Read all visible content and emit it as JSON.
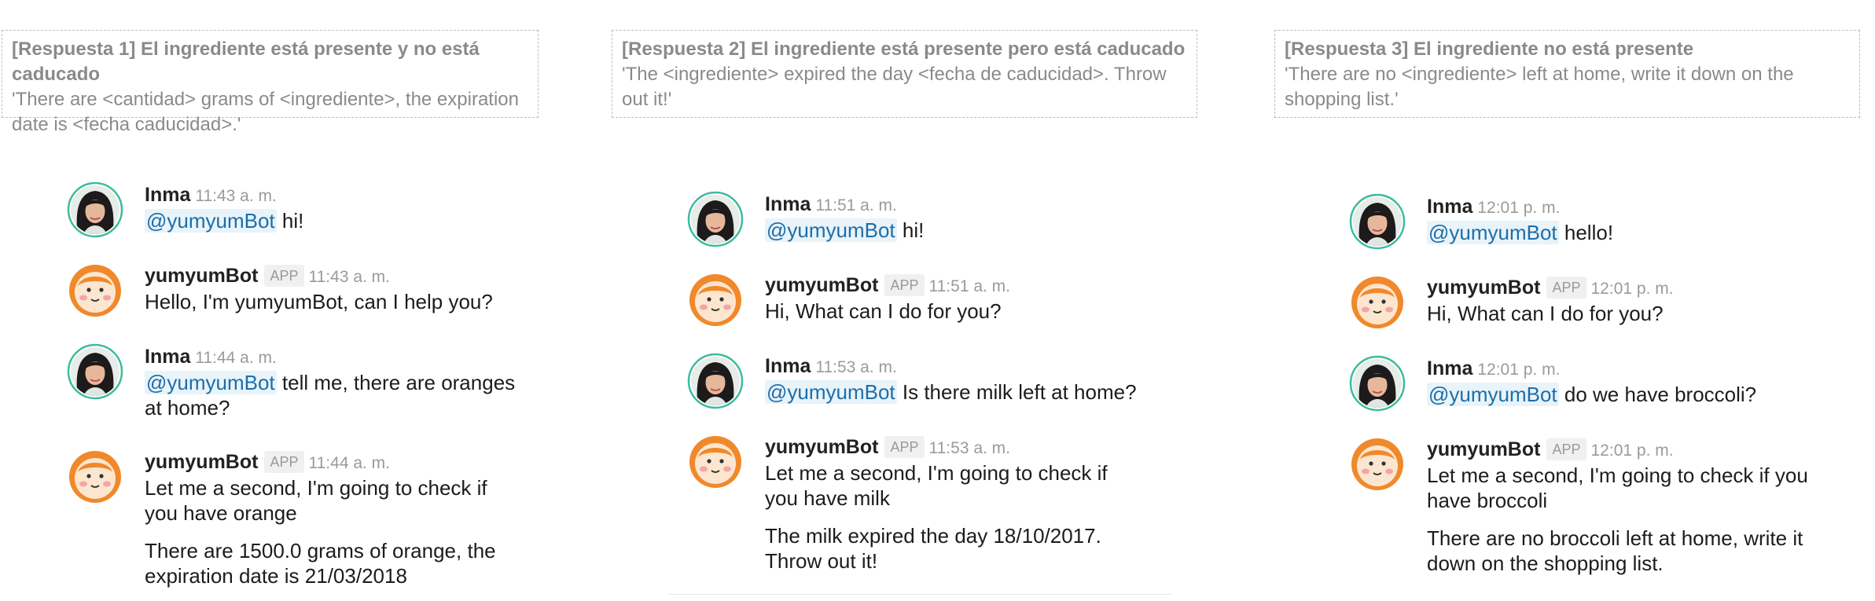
{
  "columns": [
    {
      "note": {
        "title": "[Respuesta 1] El ingrediente está presente y no está caducado",
        "text": "'There are <cantidad> grams of <ingrediente>, the expiration date is <fecha caducidad>.'"
      },
      "messages": [
        {
          "sender": "Inma",
          "time": "11:43 a. m.",
          "mention": "@yumyumBot",
          "text": " hi!"
        },
        {
          "sender": "yumyumBot",
          "badge": "APP",
          "time": "11:43 a. m.",
          "text": "Hello, I'm yumyumBot, can I help you?"
        },
        {
          "sender": "Inma",
          "time": "11:44 a. m.",
          "mention": "@yumyumBot",
          "text": " tell me, there are oranges at home?"
        },
        {
          "sender": "yumyumBot",
          "badge": "APP",
          "time": "11:44 a. m.",
          "text": "Let me a second, I'm going to check if you have orange",
          "text2": "There are 1500.0 grams of orange, the expiration date is 21/03/2018"
        }
      ]
    },
    {
      "note": {
        "title": "[Respuesta 2] El ingrediente está presente pero está caducado",
        "text": "'The <ingrediente> expired the day <fecha de caducidad>. Throw out it!'"
      },
      "messages": [
        {
          "sender": "Inma",
          "time": "11:51 a. m.",
          "mention": "@yumyumBot",
          "text": " hi!"
        },
        {
          "sender": "yumyumBot",
          "badge": "APP",
          "time": "11:51 a. m.",
          "text": "Hi, What can I do for you?"
        },
        {
          "sender": "Inma",
          "time": "11:53 a. m.",
          "mention": "@yumyumBot",
          "text": " Is there milk left at home?"
        },
        {
          "sender": "yumyumBot",
          "badge": "APP",
          "time": "11:53 a. m.",
          "text": "Let me a second, I'm going to check if you have milk",
          "text2": "The milk expired the day 18/10/2017. Throw out it!"
        }
      ]
    },
    {
      "note": {
        "title": "[Respuesta 3] El ingrediente no está presente",
        "text": "'There are no <ingrediente> left at home, write it down on the shopping list.'"
      },
      "messages": [
        {
          "sender": "Inma",
          "time": "12:01 p. m.",
          "mention": "@yumyumBot",
          "text": " hello!"
        },
        {
          "sender": "yumyumBot",
          "badge": "APP",
          "time": "12:01 p. m.",
          "text": "Hi, What can I do for you?"
        },
        {
          "sender": "Inma",
          "time": "12:01 p. m.",
          "mention": "@yumyumBot",
          "text": " do we have broccoli?"
        },
        {
          "sender": "yumyumBot",
          "badge": "APP",
          "time": "12:01 p. m.",
          "text": "Let me a second, I'm going to check if you have broccoli",
          "text2": "There are no broccoli left at home, write it down on the shopping list."
        }
      ]
    }
  ],
  "colors": {
    "mention": "#1d6ea8",
    "bot_orange": "#f0892b",
    "avatar_ring": "#3dbba0"
  }
}
